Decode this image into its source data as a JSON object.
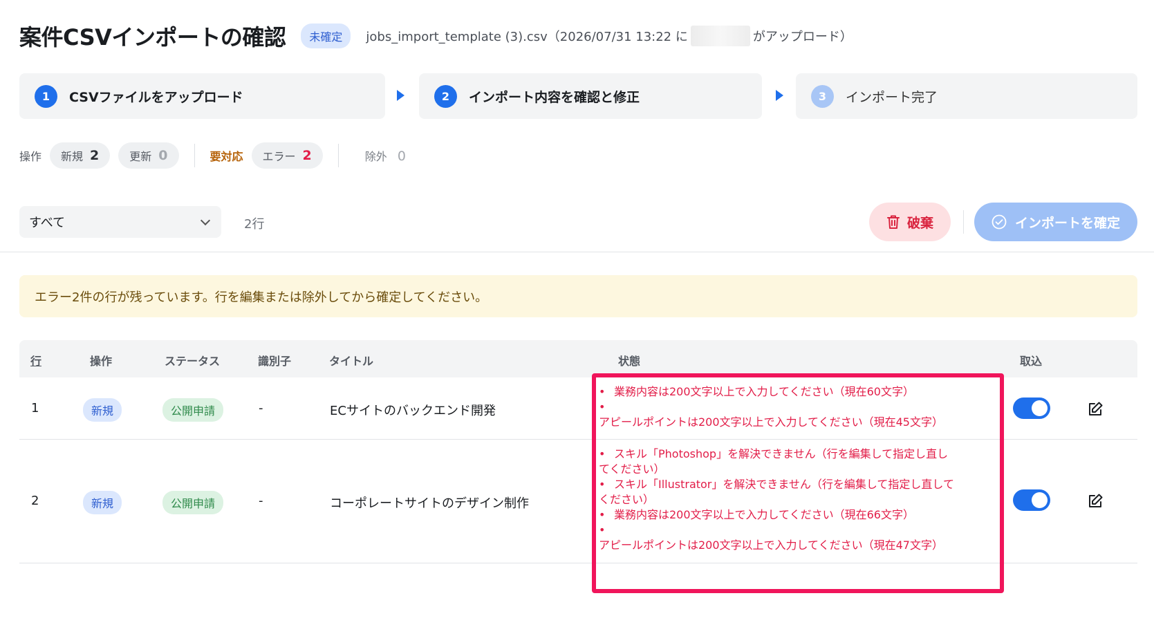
{
  "header": {
    "title": "案件CSVインポートの確認",
    "status_chip": "未確定",
    "upload_prefix": "jobs_import_template (3).csv（2026/07/31 13:22 に",
    "upload_suffix": "がアップロード）"
  },
  "steps": [
    {
      "number": "1",
      "label": "CSVファイルをアップロード",
      "state": "done"
    },
    {
      "number": "2",
      "label": "インポート内容を確認と修正",
      "state": "current"
    },
    {
      "number": "3",
      "label": "インポート完了",
      "state": "pending"
    }
  ],
  "counts": {
    "operation_label": "操作",
    "new_label": "新規",
    "new_count": "2",
    "update_label": "更新",
    "update_count": "0",
    "attention_label": "要対応",
    "error_label": "エラー",
    "error_count": "2",
    "excluded_label": "除外",
    "excluded_count": "0"
  },
  "toolbar": {
    "filter_value": "すべて",
    "row_count": "2行",
    "discard_label": "破棄",
    "confirm_label": "インポートを確定"
  },
  "alert": {
    "message": "エラー2件の行が残っています。行を編集または除外してから確定してください。"
  },
  "table": {
    "headers": {
      "row": "行",
      "operation": "操作",
      "status": "ステータス",
      "identifier": "識別子",
      "title": "タイトル",
      "state": "状態",
      "import": "取込"
    },
    "rows": [
      {
        "row": "1",
        "operation": "新規",
        "status": "公開申請",
        "identifier": "-",
        "title": "ECサイトのバックエンド開発",
        "errors": [
          "業務内容は200文字以上で入力してください（現在60文字）",
          "アピールポイントは200文字以上で入力してください（現在45文字）"
        ],
        "import_enabled": true
      },
      {
        "row": "2",
        "operation": "新規",
        "status": "公開申請",
        "identifier": "-",
        "title": "コーポレートサイトのデザイン制作",
        "errors": [
          "スキル「Photoshop」を解決できません（行を編集して指定し直してください）",
          "スキル「Illustrator」を解決できません（行を編集して指定し直してください）",
          "業務内容は200文字以上で入力してください（現在66文字）",
          "アピールポイントは200文字以上で入力してください（現在47文字）"
        ],
        "import_enabled": true
      }
    ]
  },
  "icons": {
    "trash": "trash-icon",
    "check_circle": "check-circle-icon",
    "edit": "edit-icon",
    "chevron": "chevron-down-icon"
  },
  "colors": {
    "primary": "#1f6feb",
    "error": "#e21d48",
    "highlight": "#f0155b",
    "warning_bg": "#fdf7df"
  }
}
